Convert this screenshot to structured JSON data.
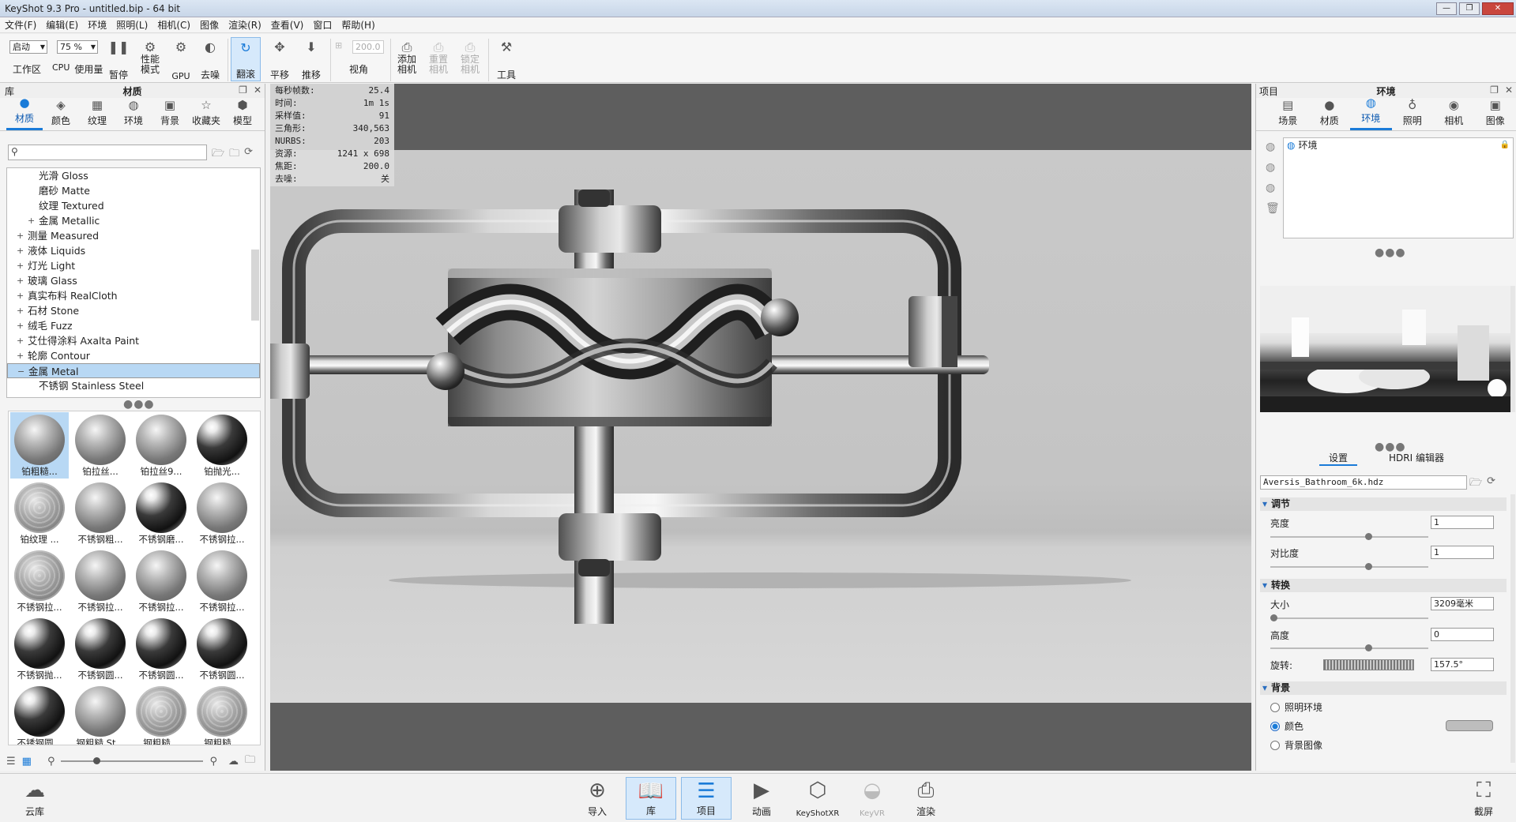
{
  "window": {
    "title": "KeyShot 9.3 Pro  - untitled.bip - 64 bit"
  },
  "menu": [
    "文件(F)",
    "编辑(E)",
    "环境",
    "照明(L)",
    "相机(C)",
    "图像",
    "渲染(R)",
    "查看(V)",
    "窗口",
    "帮助(H)"
  ],
  "toolbar": {
    "workspace_value": "启动",
    "workspace_label": "工作区",
    "cpu_value": "75 %",
    "cpu_cpu": "CPU",
    "cpu_usage": "使用量",
    "pause": "暂停",
    "perf_mode": "性能\n模式",
    "gpu": "GPU",
    "denoise": "去噪",
    "tumble": "翻滚",
    "pan": "平移",
    "dolly": "推移",
    "fov_value": "200.0",
    "fov_label": "视角",
    "add_camera": "添加\n相机",
    "reset_camera": "重置\n相机",
    "lock_camera": "锁定\n相机",
    "tools": "工具"
  },
  "library": {
    "header_left": "库",
    "title": "材质",
    "tabs": [
      "材质",
      "颜色",
      "纹理",
      "环境",
      "背景",
      "收藏夹",
      "模型"
    ],
    "active_tab": 0,
    "search_placeholder": "",
    "tree": [
      {
        "label": "光滑 Gloss",
        "indent": 2,
        "exp": ""
      },
      {
        "label": "磨砂 Matte",
        "indent": 2,
        "exp": ""
      },
      {
        "label": "纹理 Textured",
        "indent": 2,
        "exp": ""
      },
      {
        "label": "金属 Metallic",
        "indent": 2,
        "exp": "+"
      },
      {
        "label": "测量 Measured",
        "indent": 1,
        "exp": "+"
      },
      {
        "label": "液体 Liquids",
        "indent": 1,
        "exp": "+"
      },
      {
        "label": "灯光 Light",
        "indent": 1,
        "exp": "+"
      },
      {
        "label": "玻璃 Glass",
        "indent": 1,
        "exp": "+"
      },
      {
        "label": "真实布料 RealCloth",
        "indent": 1,
        "exp": "+"
      },
      {
        "label": "石材 Stone",
        "indent": 1,
        "exp": "+"
      },
      {
        "label": "绒毛 Fuzz",
        "indent": 1,
        "exp": "+"
      },
      {
        "label": "艾仕得涂料 Axalta Paint",
        "indent": 1,
        "exp": "+"
      },
      {
        "label": "轮廓 Contour",
        "indent": 1,
        "exp": "+"
      },
      {
        "label": "金属 Metal",
        "indent": 1,
        "exp": "−",
        "selected": true
      },
      {
        "label": "不锈钢 Stainless Steel",
        "indent": 2,
        "exp": ""
      }
    ],
    "materials": [
      {
        "label": "铂粗糙...",
        "style": "brushed",
        "selected": true
      },
      {
        "label": "铂拉丝...",
        "style": "brushed"
      },
      {
        "label": "铂拉丝9...",
        "style": "brushed"
      },
      {
        "label": "铂抛光...",
        "style": "polish"
      },
      {
        "label": "铂纹理 ...",
        "style": "pattern"
      },
      {
        "label": "不锈钢粗...",
        "style": "brushed"
      },
      {
        "label": "不锈钢磨...",
        "style": "polish"
      },
      {
        "label": "不锈钢拉...",
        "style": "brushed"
      },
      {
        "label": "不锈钢拉...",
        "style": "pattern"
      },
      {
        "label": "不锈钢拉...",
        "style": "brushed"
      },
      {
        "label": "不锈钢拉...",
        "style": "brushed"
      },
      {
        "label": "不锈钢拉...",
        "style": "brushed"
      },
      {
        "label": "不锈钢抛...",
        "style": "polish"
      },
      {
        "label": "不锈钢圆...",
        "style": "polish"
      },
      {
        "label": "不锈钢圆...",
        "style": "polish"
      },
      {
        "label": "不锈钢圆...",
        "style": "polish"
      },
      {
        "label": "不锈钢圆...",
        "style": "polish"
      },
      {
        "label": "钢粗糙 St...",
        "style": "brushed"
      },
      {
        "label": "钢粗糙...",
        "style": "pattern"
      },
      {
        "label": "钢粗糙...",
        "style": "pattern"
      }
    ],
    "zoom_level": 0.25
  },
  "stats": [
    {
      "k": "每秒帧数:",
      "v": "25.4"
    },
    {
      "k": "时间:",
      "v": "1m 1s"
    },
    {
      "k": "采样值:",
      "v": "91"
    },
    {
      "k": "三角形:",
      "v": "340,563"
    },
    {
      "k": "NURBS:",
      "v": "203"
    },
    {
      "k": "资源:",
      "v": "1241 x 698"
    },
    {
      "k": "焦距:",
      "v": "200.0"
    },
    {
      "k": "去噪:",
      "v": "关"
    }
  ],
  "project": {
    "header_left": "项目",
    "title": "环境",
    "tabs": [
      "场景",
      "材质",
      "环境",
      "照明",
      "相机",
      "图像"
    ],
    "active_tab": 2,
    "scene_item": "环境",
    "subtabs": [
      "设置",
      "HDRI 编辑器"
    ],
    "hdri_file": "Aversis_Bathroom_6k.hdz",
    "sections": {
      "adjust": "调节",
      "transform": "转换",
      "background": "背景"
    },
    "brightness_label": "亮度",
    "brightness_value": "1",
    "brightness_level": 0.62,
    "contrast_label": "对比度",
    "contrast_value": "1",
    "contrast_level": 0.62,
    "size_label": "大小",
    "size_value": "3209毫米",
    "size_level": 0.02,
    "height_label": "高度",
    "height_value": "0",
    "height_level": 0.62,
    "rotation_label": "旋转:",
    "rotation_value": "157.5°",
    "bg_options": [
      "照明环境",
      "颜色",
      "背景图像"
    ],
    "bg_selected": 1,
    "bg_color": "#bdbdbd"
  },
  "bottombar": {
    "cloud": "云库",
    "import": "导入",
    "library": "库",
    "project": "项目",
    "animation": "动画",
    "keyshotxr": "KeyShotXR",
    "keyvr": "KeyVR",
    "render": "渲染",
    "screenshot": "截屏"
  },
  "colors": {
    "accent": "#1a7bd8",
    "selection": "#b8d8f4",
    "viewport_bg": "#5e5e5e"
  }
}
